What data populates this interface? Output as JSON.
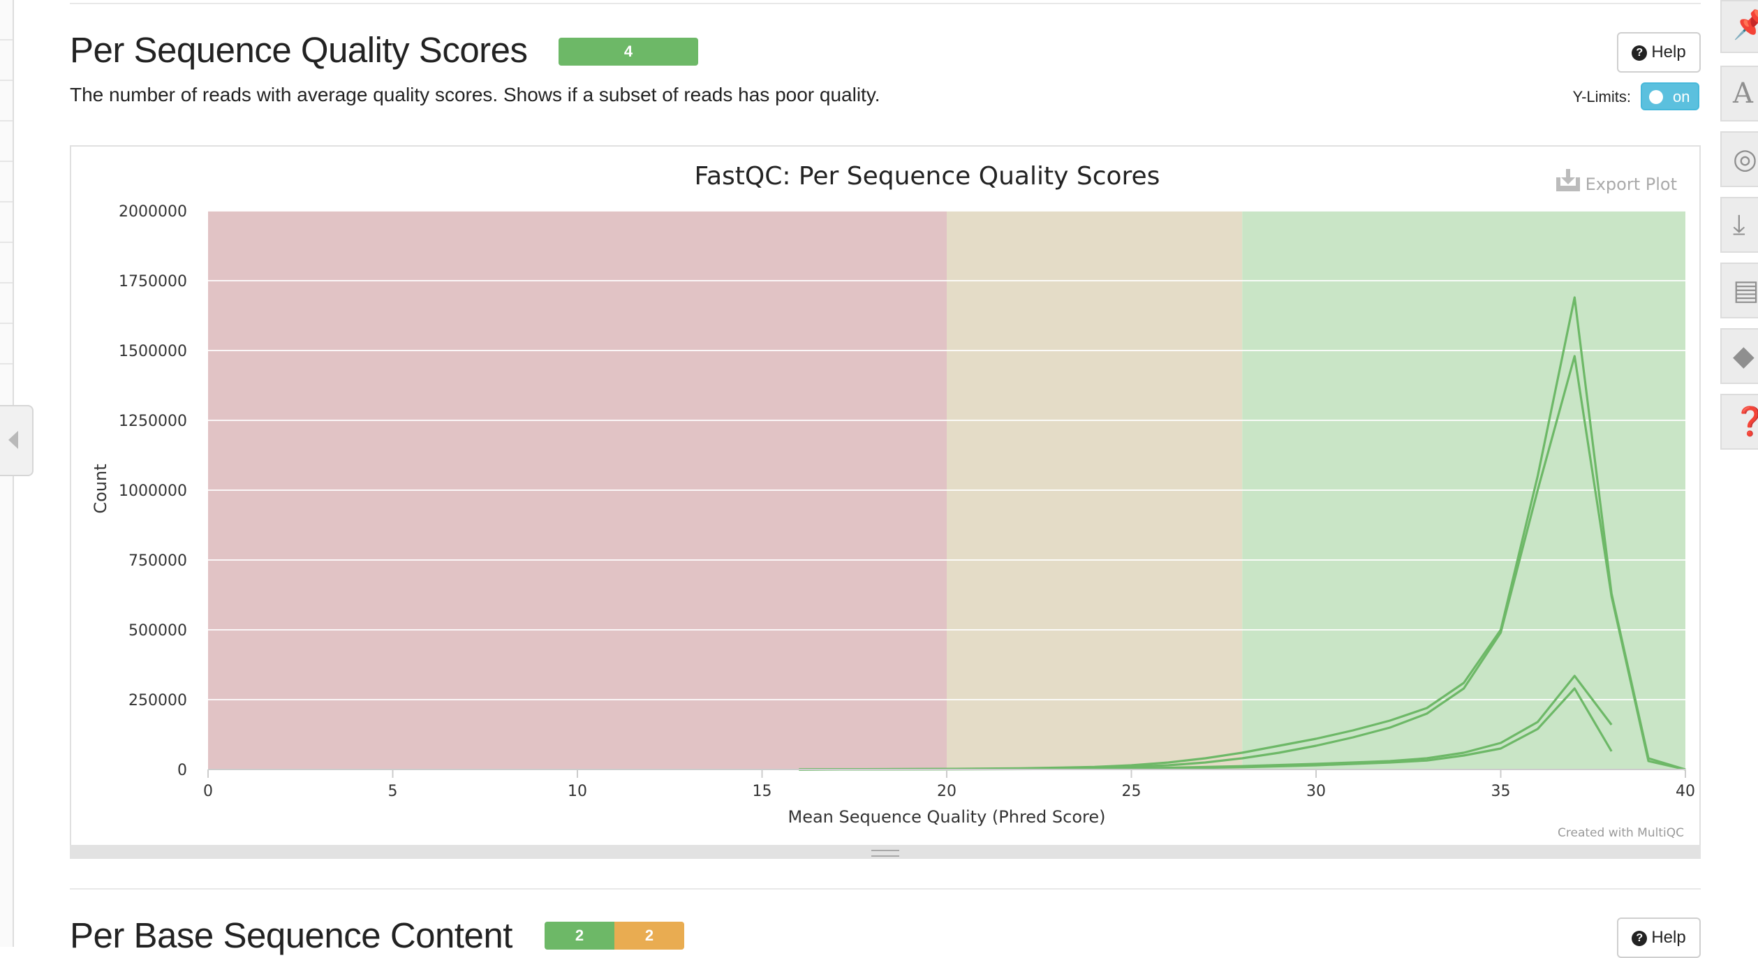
{
  "section1": {
    "title": "Per Sequence Quality Scores",
    "badge_value": "4",
    "badge_color": "#6db867",
    "description": "The number of reads with average quality scores. Shows if a subset of reads has poor quality.",
    "help_label": "Help",
    "ylimits_label": "Y-Limits:",
    "ylimits_toggle": "on",
    "export_label": "Export Plot",
    "credit": "Created with MultiQC"
  },
  "section2": {
    "title": "Per Base Sequence Content",
    "badges": [
      {
        "value": "2",
        "color": "#6db867"
      },
      {
        "value": "2",
        "color": "#e9ac51"
      }
    ],
    "help_label": "Help"
  },
  "sidebar_icons": [
    "pin-icon",
    "font-icon",
    "eye-slash-icon",
    "download-icon",
    "save-icon",
    "graduation-cap-icon",
    "question-icon"
  ],
  "chart_data": {
    "type": "line",
    "title": "FastQC: Per Sequence Quality Scores",
    "xlabel": "Mean Sequence Quality (Phred Score)",
    "ylabel": "Count",
    "xlim": [
      0,
      40
    ],
    "ylim": [
      0,
      2000000
    ],
    "x_ticks": [
      0,
      5,
      10,
      15,
      20,
      25,
      30,
      35,
      40
    ],
    "y_ticks": [
      0,
      250000,
      500000,
      750000,
      1000000,
      1250000,
      1500000,
      1750000,
      2000000
    ],
    "grid": true,
    "line_color": "#6db867",
    "bands": [
      {
        "from": 0,
        "to": 20,
        "color": "#e1c3c5"
      },
      {
        "from": 20,
        "to": 28,
        "color": "#e4dcc7"
      },
      {
        "from": 28,
        "to": 40.4,
        "color": "#c9e5c6"
      }
    ],
    "series": [
      {
        "x": [
          16,
          20,
          22,
          24,
          25,
          26,
          27,
          28,
          29,
          30,
          31,
          32,
          33,
          34,
          35,
          36,
          37,
          38,
          39,
          40
        ],
        "y": [
          0,
          2000,
          4000,
          9000,
          15000,
          25000,
          40000,
          60000,
          85000,
          110000,
          140000,
          175000,
          220000,
          310000,
          500000,
          1050000,
          1690000,
          630000,
          40000,
          0
        ]
      },
      {
        "x": [
          16,
          20,
          22,
          24,
          25,
          26,
          27,
          28,
          29,
          30,
          31,
          32,
          33,
          34,
          35,
          36,
          37,
          38,
          39,
          40
        ],
        "y": [
          0,
          1500,
          3000,
          6000,
          10000,
          15000,
          25000,
          40000,
          60000,
          85000,
          115000,
          150000,
          200000,
          290000,
          490000,
          1000000,
          1480000,
          620000,
          30000,
          0
        ]
      },
      {
        "x": [
          16,
          20,
          24,
          26,
          28,
          30,
          32,
          33,
          34,
          35,
          36,
          37,
          38
        ],
        "y": [
          0,
          1000,
          3000,
          6000,
          12000,
          20000,
          30000,
          40000,
          60000,
          95000,
          170000,
          335000,
          160000
        ]
      },
      {
        "x": [
          16,
          20,
          24,
          26,
          28,
          30,
          32,
          33,
          34,
          35,
          36,
          37,
          38
        ],
        "y": [
          0,
          800,
          2000,
          4000,
          8000,
          15000,
          25000,
          32000,
          50000,
          75000,
          145000,
          290000,
          65000
        ]
      }
    ]
  }
}
